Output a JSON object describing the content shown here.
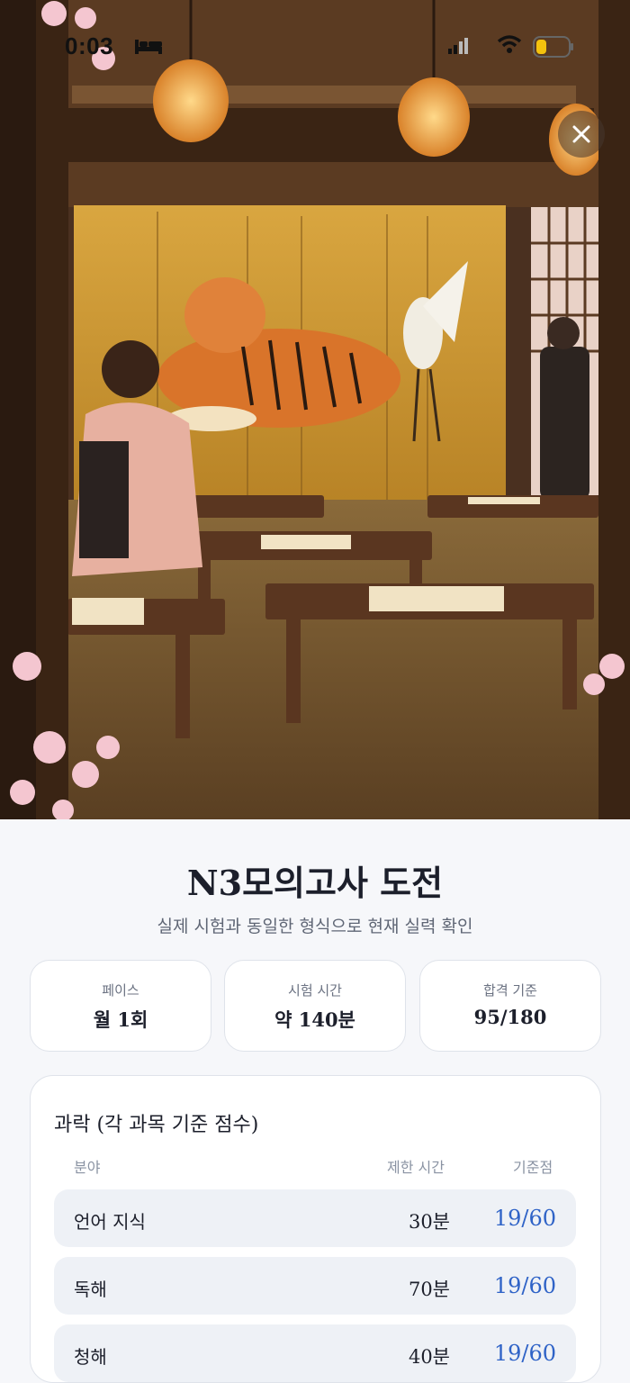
{
  "status_bar": {
    "time": "0:03"
  },
  "hero": {
    "image_alt": "tiger-screen-exam-hall-illustration"
  },
  "close_icon": "close-icon",
  "title": "N3모의고사 도전",
  "subtitle": "실제 시험과 동일한 형식으로 현재 실력 확인",
  "info_cards": [
    {
      "label": "페이스",
      "value": "월 1회"
    },
    {
      "label": "시험 시간",
      "value": "약 140분"
    },
    {
      "label": "합격 기준",
      "value": "95/180"
    }
  ],
  "outline": {
    "title": "과락 (각 과목 기준 점수)",
    "headers": {
      "section": "분야",
      "time": "제한 시간",
      "score": "기준점"
    },
    "rows": [
      {
        "name": "언어 지식",
        "time": "30분",
        "score": "19/60"
      },
      {
        "name": "독해",
        "time": "70분",
        "score": "19/60"
      },
      {
        "name": "청해",
        "time": "40분",
        "score": "19/60"
      }
    ]
  },
  "colors": {
    "accent": "#2f63c7",
    "background": "#f6f7fa",
    "title": "#1c1f2b"
  }
}
